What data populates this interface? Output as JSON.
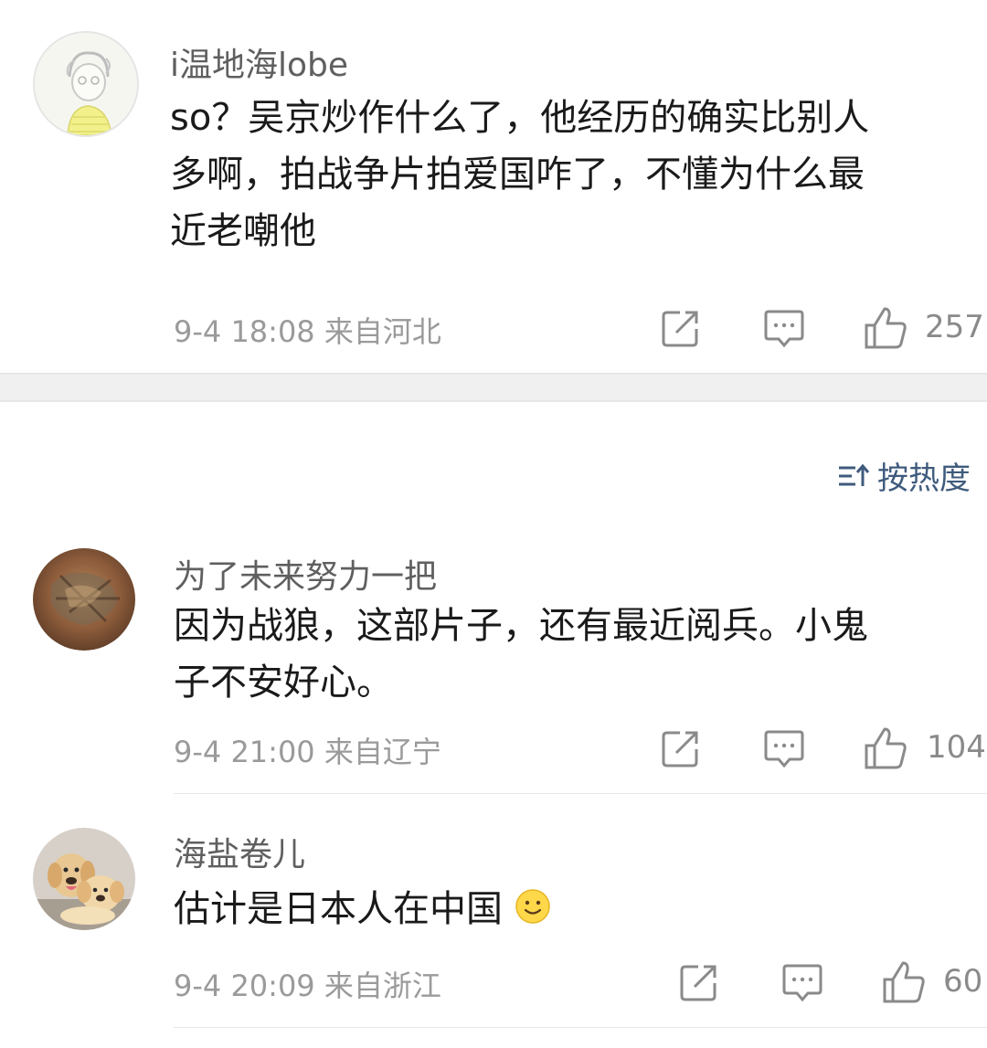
{
  "top_comment": {
    "username": "i温地海lobe",
    "text_lines": [
      "so？吴京炒作什么了，他经历的确实比别人",
      "多啊，拍战争片拍爱国咋了，不懂为什么最",
      "近老嘲他"
    ],
    "meta": "9-4 18:08 来自河北",
    "likes": "257"
  },
  "sort": {
    "label": "按热度",
    "icon": "sort-icon"
  },
  "comments": [
    {
      "username": "为了未来努力一把",
      "text_lines": [
        "因为战狼，这部片子，还有最近阅兵。小鬼",
        "子不安好心。"
      ],
      "meta": "9-4 21:00 来自辽宁",
      "likes": "104"
    },
    {
      "username": "海盐卷儿",
      "text": "估计是日本人在中国",
      "emoji": "smile-emoji",
      "meta": "9-4 20:09 来自浙江",
      "likes": "60"
    }
  ],
  "icons": {
    "share": "share-icon",
    "comment": "comment-icon",
    "like": "like-icon"
  },
  "colors": {
    "meta_gray": "#9a9a9a",
    "sort_blue": "#3f5b7d",
    "band": "#f0f0f0"
  }
}
